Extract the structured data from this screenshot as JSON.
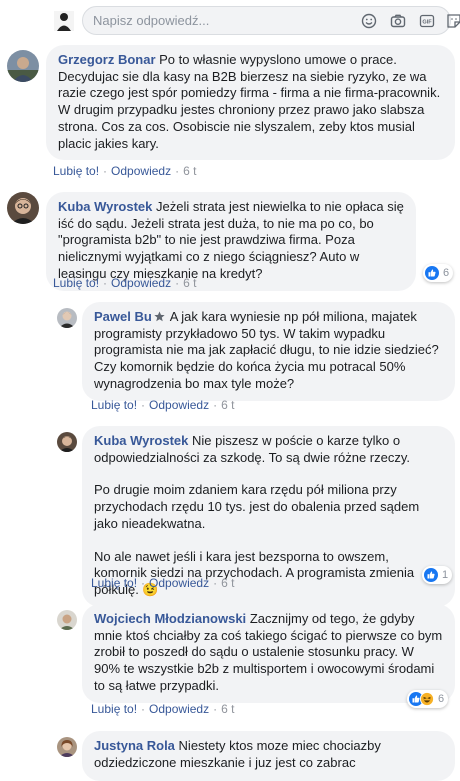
{
  "reply_box": {
    "placeholder": "Napisz odpowiedź..."
  },
  "comments": [
    {
      "author": "Grzegorz Bonar",
      "paragraphs": [
        "Po to własnie wypyslono umowe o prace. Decydujac sie dla kasy na B2B bierzesz na siebie ryzyko, ze wa razie czego jest spór pomiedzy firma - firma a nie firma-pracownik. W drugim przypadku jestes chroniony przez prawo jako slabsza strona. Cos za cos. Osobiscie nie slyszalem, zeby ktos musial placic jakies kary."
      ],
      "like_label": "Lubię to!",
      "reply_label": "Odpowiedz",
      "time": "6 t"
    },
    {
      "author": "Kuba Wyrostek",
      "paragraphs": [
        "Jeżeli strata jest niewielka to nie opłaca się iść do sądu. Jeżeli strata jest duża, to nie ma po co, bo \"programista b2b\" to nie jest prawdziwa firma. Poza nielicznymi wyjątkami co z niego ściągniesz? Auto w leasingu czy mieszkanie na kredyt?"
      ],
      "like_label": "Lubię to!",
      "reply_label": "Odpowiedz",
      "time": "6 t",
      "reactions": "6"
    },
    {
      "author": "Pawel Bu",
      "paragraphs": [
        "A jak kara wyniesie np pół miliona, majatek programisty przykładowo 50 tys. W takim wypadku programista nie ma jak zapłacić długu, to nie idzie siedzieć? Czy komornik będzie do końca życia mu potracal 50% wynagrodzenia bo max tyle może?"
      ],
      "like_label": "Lubię to!",
      "reply_label": "Odpowiedz",
      "time": "6 t"
    },
    {
      "author": "Kuba Wyrostek",
      "paragraphs": [
        "Nie piszesz w poście o karze tylko o odpowiedzialności za szkodę. To są dwie różne rzeczy.",
        "Po drugie moim zdaniem kara rzędu pół miliona przy przychodach rzędu 10 tys. jest do obalenia przed sądem jako nieadekwatna.",
        "No ale nawet jeśli i kara jest bezsporna to owszem, komornik siedzi na przychodach. A programista zmienia półkulę. 😉"
      ],
      "like_label": "Lubię to!",
      "reply_label": "Odpowiedz",
      "time": "6 t",
      "reactions": "1"
    },
    {
      "author": "Wojciech Młodzianowski",
      "paragraphs": [
        "Zacznijmy od tego, że gdyby mnie ktoś chciałby za coś takiego ścigać to pierwsze co bym zrobił to poszedł do sądu o ustalenie stosunku pracy. W 90% te wszystkie b2b z multisportem i owocowymi środami to są łatwe przypadki."
      ],
      "like_label": "Lubię to!",
      "reply_label": "Odpowiedz",
      "time": "6 t",
      "reactions": "6"
    },
    {
      "author": "Justyna Rola",
      "paragraphs": [
        "Niestety ktos moze miec chociazby odziedziczone mieszkanie i juz jest co zabrac"
      ]
    }
  ],
  "colors": {
    "author": "#385898",
    "bubble": "#f2f3f5",
    "like_blue": "#1877f2",
    "meta": "#90949c"
  }
}
